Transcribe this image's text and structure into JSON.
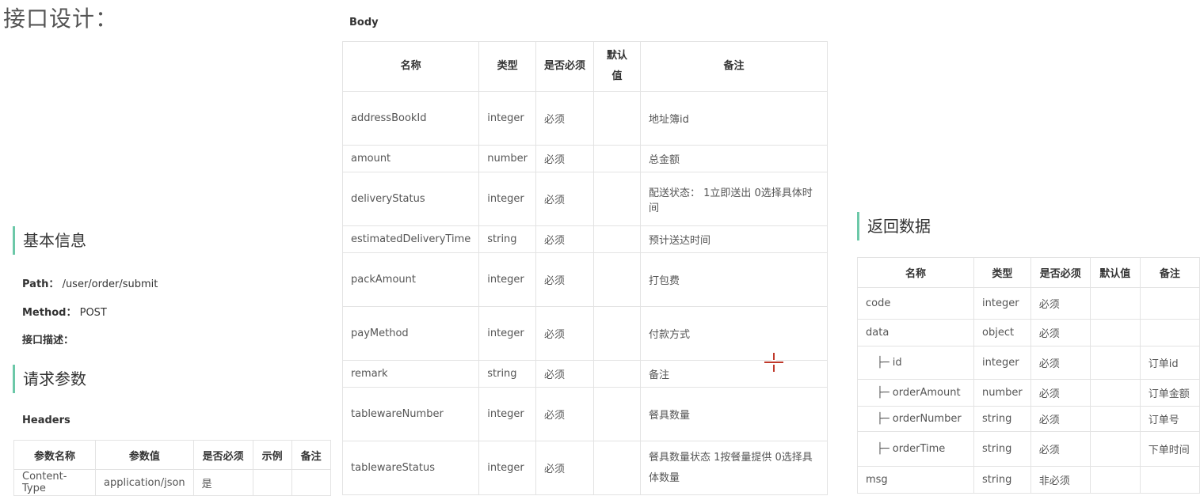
{
  "page_title": "接口设计：",
  "basic": {
    "heading": "基本信息",
    "path_label": "Path：",
    "path_value": "/user/order/submit",
    "method_label": "Method：",
    "method_value": "POST",
    "desc_label": "接口描述："
  },
  "request": {
    "heading": "请求参数",
    "headers_label": "Headers",
    "headers_columns": [
      "参数名称",
      "参数值",
      "是否必须",
      "示例",
      "备注"
    ],
    "headers_rows": [
      [
        "Content-Type",
        "application/json",
        "是",
        "",
        ""
      ]
    ],
    "body_label": "Body",
    "body_columns": [
      "名称",
      "类型",
      "是否必须",
      "默认值",
      "备注"
    ],
    "body_rows": [
      [
        "addressBookId",
        "integer",
        "必须",
        "",
        "地址簿id"
      ],
      [
        "amount",
        "number",
        "必须",
        "",
        "总金额"
      ],
      [
        "deliveryStatus",
        "integer",
        "必须",
        "",
        "配送状态： 1立即送出 0选择具体时间"
      ],
      [
        "estimatedDeliveryTime",
        "string",
        "必须",
        "",
        "预计送达时间"
      ],
      [
        "packAmount",
        "integer",
        "必须",
        "",
        "打包费"
      ],
      [
        "payMethod",
        "integer",
        "必须",
        "",
        "付款方式"
      ],
      [
        "remark",
        "string",
        "必须",
        "",
        "备注"
      ],
      [
        "tablewareNumber",
        "integer",
        "必须",
        "",
        "餐具数量"
      ],
      [
        "tablewareStatus",
        "integer",
        "必须",
        "",
        "餐具数量状态 1按餐量提供 0选择具体数量"
      ]
    ]
  },
  "response": {
    "heading": "返回数据",
    "columns": [
      "名称",
      "类型",
      "是否必须",
      "默认值",
      "备注"
    ],
    "rows": [
      [
        "code",
        "integer",
        "必须",
        "",
        ""
      ],
      [
        "data",
        "object",
        "必须",
        "",
        ""
      ],
      [
        "├─ id",
        "integer",
        "必须",
        "",
        "订单id"
      ],
      [
        "├─ orderAmount",
        "number",
        "必须",
        "",
        "订单金额"
      ],
      [
        "├─ orderNumber",
        "string",
        "必须",
        "",
        "订单号"
      ],
      [
        "├─ orderTime",
        "string",
        "必须",
        "",
        "下单时间"
      ],
      [
        "msg",
        "string",
        "非必须",
        "",
        ""
      ]
    ]
  }
}
